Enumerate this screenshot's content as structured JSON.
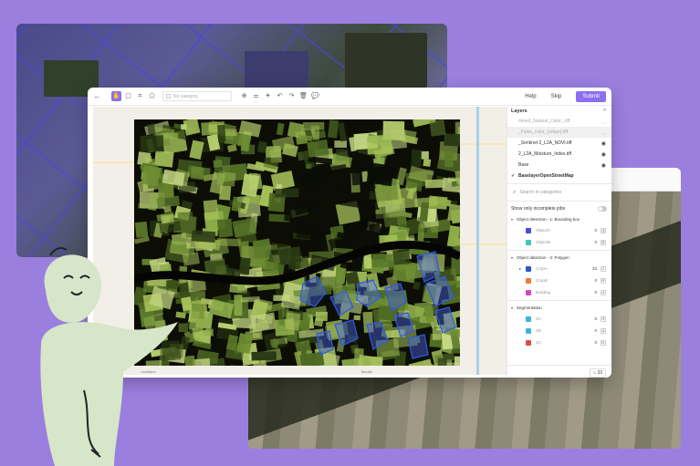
{
  "toolbar": {
    "category_placeholder": "No category",
    "help_label": "Help",
    "skip_label": "Skip",
    "submit_label": "Submit"
  },
  "layers_panel": {
    "title": "Layers",
    "layers": [
      {
        "label": "mixed_Natural_Color_.tiff",
        "dim": true,
        "visible": false
      },
      {
        "label": "_False_color_(urban).tiff",
        "dim": true,
        "visible": false,
        "selected": true
      },
      {
        "label": "_Sentinel-2_L2A_NDVI.tiff",
        "dim": false,
        "visible": true
      },
      {
        "label": "2_L2A_Moisture_Index.tiff",
        "dim": false,
        "visible": true
      }
    ],
    "base_label": "Base",
    "base_layer": "BaselayerOpenStreetMap",
    "search_placeholder": "Search in categories",
    "toggle_label": "Show only incomplete jobs",
    "groups": [
      {
        "label": "Object detection - 1: Bounding box",
        "categories": [
          {
            "label": "ObjectA",
            "count": "0",
            "key": "Q",
            "color": "#4b4fd8"
          },
          {
            "label": "ObjectB",
            "count": "0",
            "key": "B",
            "color": "#3fc7b0"
          }
        ]
      },
      {
        "label": "Object detection - 2: Polygon",
        "categories": [
          {
            "label": "CropA",
            "count": "33",
            "key": "C",
            "color": "#3554c9"
          },
          {
            "label": "CropB",
            "count": "0",
            "key": "R",
            "color": "#f07c3a"
          },
          {
            "label": "Building",
            "count": "0",
            "key": "U",
            "color": "#d646c2"
          }
        ]
      },
      {
        "label": "Segmentation",
        "categories": [
          {
            "label": "SA",
            "count": "0",
            "key": "S",
            "color": "#3fb3e0"
          },
          {
            "label": "SB",
            "count": "0",
            "key": "A",
            "color": "#3fb3e0"
          },
          {
            "label": "SC",
            "count": "0",
            "key": "D",
            "color": "#e24a4a"
          }
        ]
      }
    ],
    "footer_count": "33"
  },
  "map": {
    "labels": [
      "Lauthiers",
      "Moulin"
    ]
  }
}
